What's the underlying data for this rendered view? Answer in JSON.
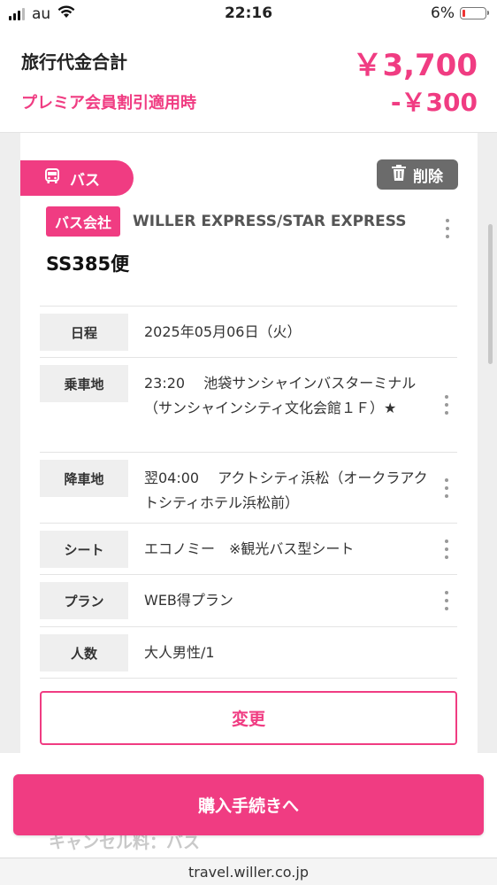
{
  "status_bar": {
    "carrier": "au",
    "time": "22:16",
    "battery_percent": "6%",
    "battery_level": 0.06,
    "icons": [
      "signal-icon",
      "wifi-icon",
      "battery-icon"
    ]
  },
  "price_header": {
    "total_label": "旅行代金合計",
    "total_amount": "￥3,700",
    "discount_label": "プレミア会員割引適用時",
    "discount_amount": "-￥300"
  },
  "card": {
    "category_tab": {
      "icon": "bus-icon",
      "label": "バス"
    },
    "delete_button": {
      "icon": "trash-icon",
      "label": "削除"
    },
    "company_badge": "バス会社",
    "company_name": "WILLER EXPRESS/STAR EXPRESS",
    "flight_number": "SS385便",
    "details": [
      {
        "label": "日程",
        "value": "2025年05月06日（火）"
      },
      {
        "label": "乗車地",
        "value": "23:20　 池袋サンシャインバスターミナル（サンシャインシティ文化会館１Ｆ）★"
      },
      {
        "label": "降車地",
        "value": "翌04:00　 アクトシティ浜松（オークラアクトシティホテル浜松前）"
      },
      {
        "label": "シート",
        "value": "エコノミー　※観光バス型シート"
      },
      {
        "label": "プラン",
        "value": "WEB得プラン"
      },
      {
        "label": "人数",
        "value": "大人男性/1"
      }
    ],
    "change_button": "変更"
  },
  "bottom": {
    "purchase_button": "購入手続きへ",
    "obscured_text": "キャンセル料：バス",
    "url": "travel.willer.co.jp"
  },
  "colors": {
    "accent": "#f03c82",
    "delete_bg": "#6b6b6b",
    "table_header_bg": "#efefef"
  }
}
